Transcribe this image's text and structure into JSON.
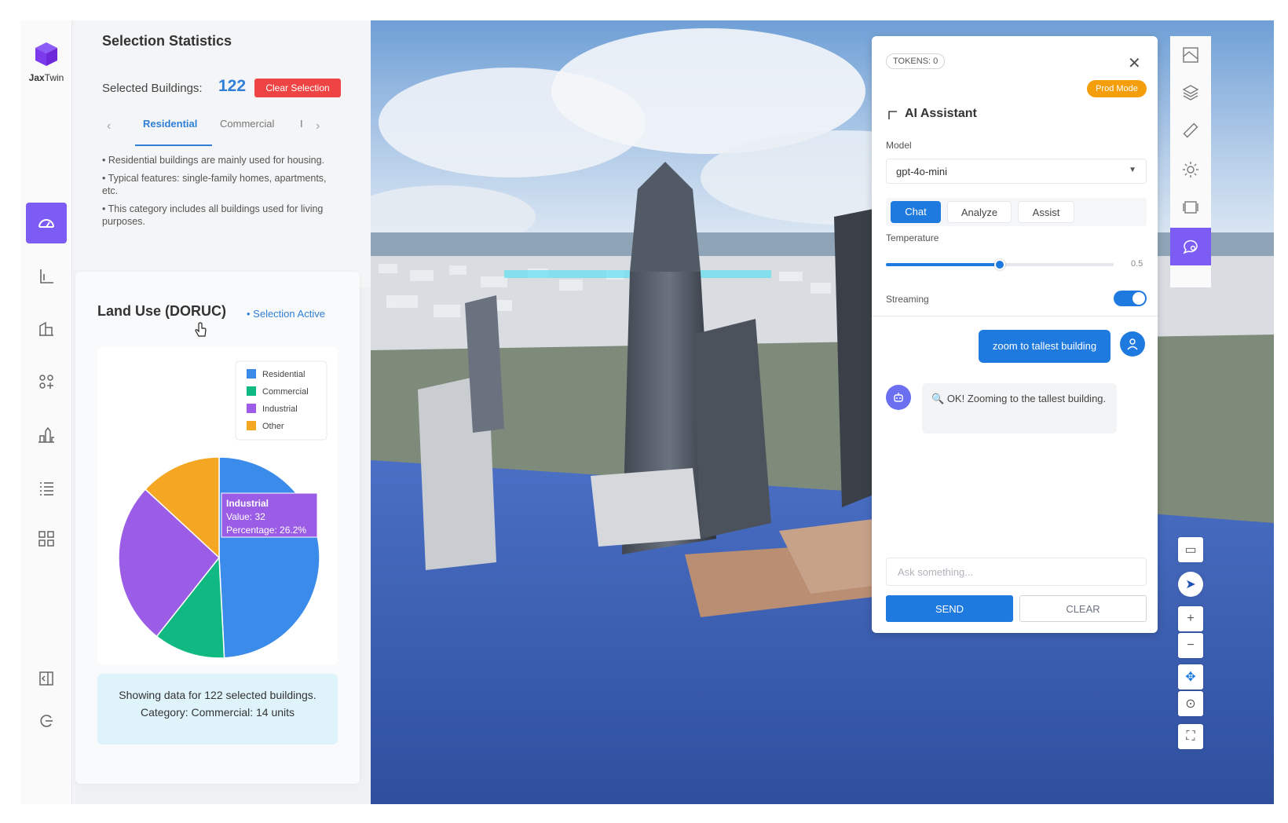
{
  "app": {
    "logo_bold": "Jax",
    "logo_rest": "Twin"
  },
  "nav": {
    "items": [
      {
        "icon": "dashboard-gauge-icon",
        "active": true
      },
      {
        "icon": "chart-axis-icon"
      },
      {
        "icon": "buildings-icon"
      },
      {
        "icon": "grid-plus-icon"
      },
      {
        "icon": "city-skyline-icon"
      },
      {
        "icon": "list-icon"
      },
      {
        "icon": "qr-grid-icon"
      },
      {
        "icon": "collapse-panel-icon"
      },
      {
        "icon": "logout-icon"
      }
    ]
  },
  "stats": {
    "title": "Selection Statistics",
    "selected_label": "Selected Buildings:",
    "selected_count": "122",
    "clear_selection": "Clear Selection",
    "tabs": [
      "Residential",
      "Commercial",
      "I"
    ],
    "bullets": [
      "• Residential buildings are mainly used for housing.",
      "• Typical features: single-family homes, apartments, etc.",
      "• This category includes all buildings used for living purposes."
    ]
  },
  "land_use": {
    "title": "Land Use (DORUC)",
    "status": "• Selection Active",
    "info": "Showing data for 122 selected buildings. Category: Commercial: 14 units"
  },
  "chart_data": {
    "type": "pie",
    "categories": [
      "Residential",
      "Commercial",
      "Industrial",
      "Other"
    ],
    "values": [
      60,
      14,
      32,
      16
    ],
    "colors": [
      "#3b8beb",
      "#10b981",
      "#9b5de5",
      "#f5a623"
    ],
    "legend_position": "top-right",
    "tooltip": {
      "title": "Industrial",
      "value_line": "Value: 32",
      "percent_line": "Percentage: 26.2%"
    }
  },
  "ai": {
    "tokens": "TOKENS: 0",
    "close": "✕",
    "prod_mode": "Prod Mode",
    "title": "AI Assistant",
    "model_label": "Model",
    "model_value": "gpt-4o-mini",
    "modes": [
      "Chat",
      "Analyze",
      "Assist"
    ],
    "temperature_label": "Temperature",
    "temperature_value": "0.5",
    "temperature": 0.5,
    "streaming_label": "Streaming",
    "streaming_on": true,
    "user_message": "zoom to tallest building",
    "bot_message": "OK! Zooming to the tallest building.",
    "input_placeholder": "Ask something...",
    "send": "SEND",
    "clear": "CLEAR"
  },
  "toolbar": {
    "items": [
      "map-layout-icon",
      "layers-icon",
      "ruler-icon",
      "sun-icon",
      "frame-icon",
      "chat-search-icon"
    ],
    "map_controls": [
      "monitor-icon",
      "pointer-icon",
      "+",
      "−",
      "✥",
      "⊙",
      "⛶"
    ]
  }
}
